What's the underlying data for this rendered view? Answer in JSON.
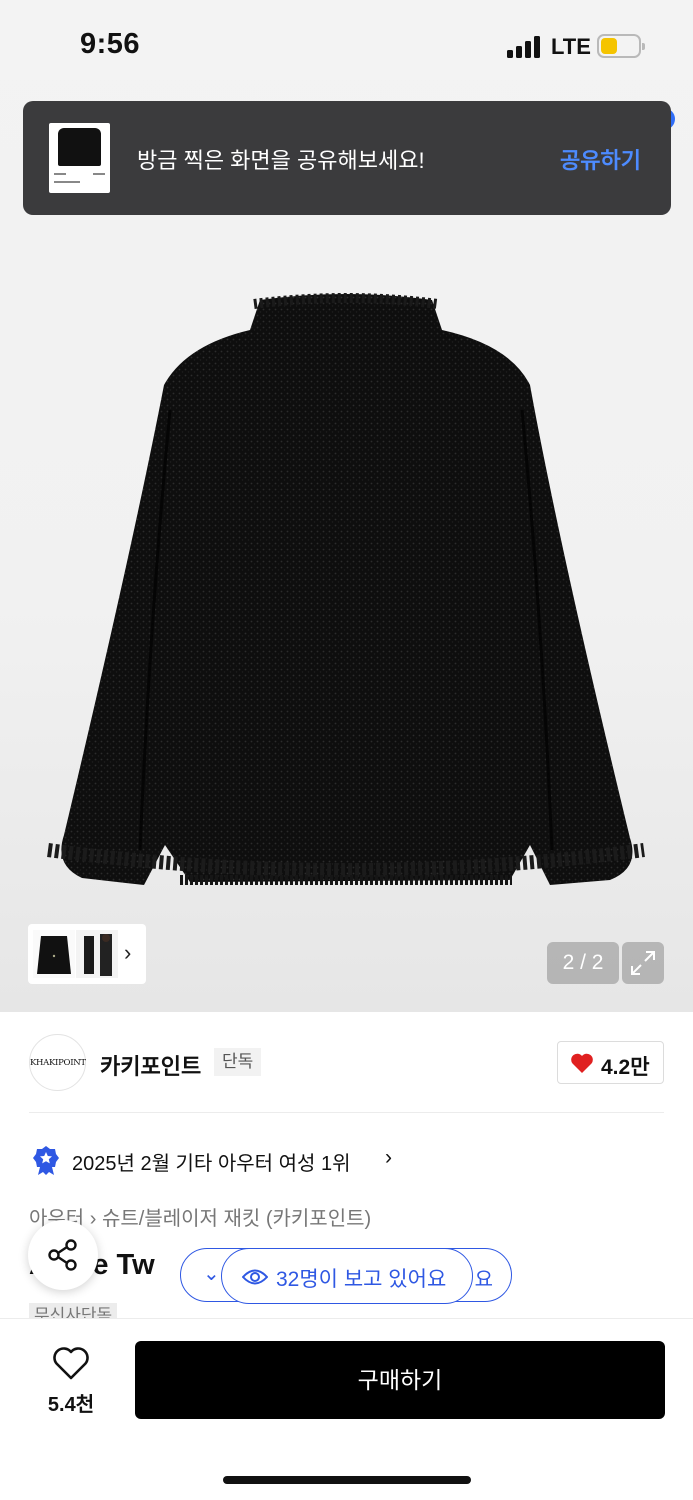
{
  "status_bar": {
    "time": "9:56",
    "network": "LTE",
    "battery_level": 0.45,
    "battery_color": "#f5c400"
  },
  "toast": {
    "message": "방금 찍은 화면을 공유해보세요!",
    "action_label": "공유하기",
    "action_color": "#4d8bff"
  },
  "gallery": {
    "counter": "2 / 2",
    "thumbnail_next_icon": "chevron-right-icon",
    "expand_icon": "expand-icon"
  },
  "brand": {
    "logo_text": "KHAKIPOINT",
    "name": "카키포인트",
    "badge": "단독",
    "likes": "4.2만",
    "like_icon": "heart-icon",
    "like_color": "#e02020"
  },
  "ranking": {
    "icon": "star-badge-icon",
    "text": "2025년 2월 기타 아우터 여성 1위",
    "chevron": "›"
  },
  "breadcrumb": {
    "text": "아우터 › 슈트/블레이저 재킷 (카키포인트)"
  },
  "product": {
    "title_visible": "A  que Tw",
    "badge": "무신사단독"
  },
  "viewers": {
    "text": "32명이 보고 있어요",
    "tail": "요",
    "icon": "eye-icon",
    "accent": "#2f58e3"
  },
  "bottom_bar": {
    "wish_count": "5.4천",
    "wish_icon": "heart-outline-icon",
    "buy_label": "구매하기"
  }
}
